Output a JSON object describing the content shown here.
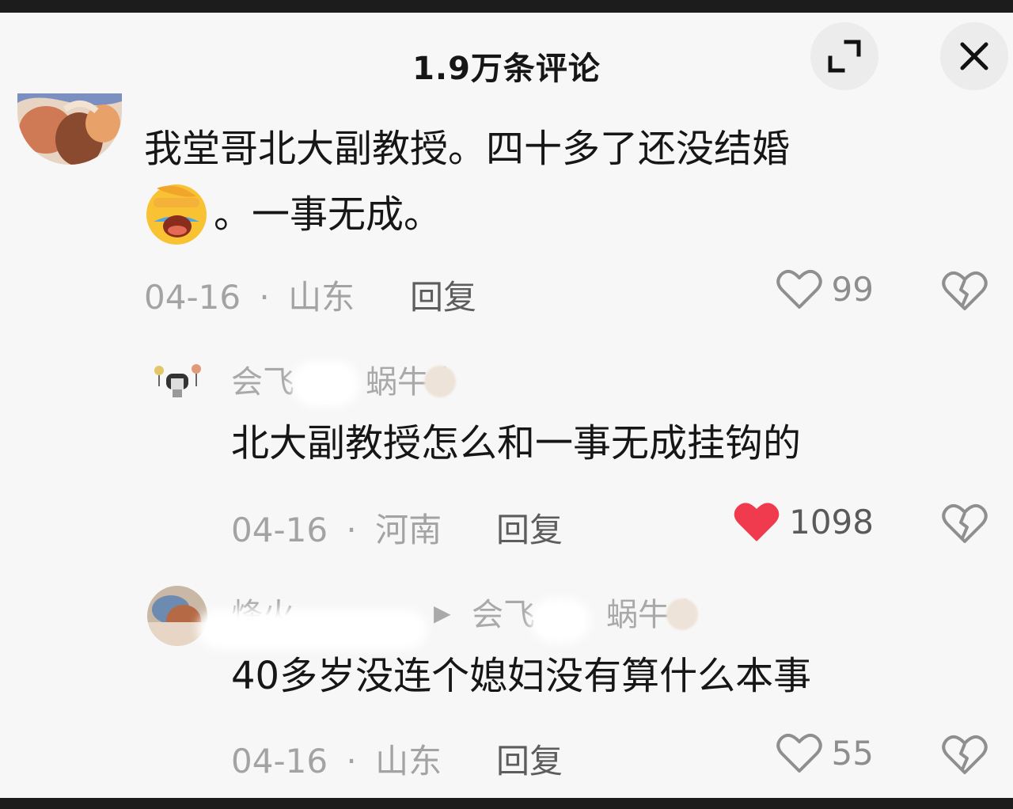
{
  "header": {
    "title": "1.9万条评论"
  },
  "comments": [
    {
      "text_line1": "我堂哥北大副教授。四十多了还没结婚",
      "text_line2": "。一事无成。",
      "date": "04-16",
      "separator": "·",
      "location": "山东",
      "reply_label": "回复",
      "likes": "99",
      "liked": false,
      "emoji": "face-palm-crying-emoji"
    },
    {
      "username_prefix": "会飞",
      "username_suffix": "蜗牛",
      "text": "北大副教授怎么和一事无成挂钩的",
      "date": "04-16",
      "separator": "·",
      "location": "河南",
      "reply_label": "回复",
      "likes": "1098",
      "liked": true
    },
    {
      "username": "烽火",
      "reply_to_prefix": "会飞",
      "reply_to_suffix": "蜗牛",
      "text": "40多岁没连个媳妇没有算什么本事",
      "date": "04-16",
      "separator": "·",
      "location": "山东",
      "reply_label": "回复",
      "likes": "55",
      "liked": false
    }
  ],
  "colors": {
    "like_active": "#f03a4d",
    "icon_gray": "#8f8f8f"
  },
  "icons": {
    "expand": "expand-icon",
    "close": "close-icon",
    "like": "heart-icon",
    "dislike": "broken-heart-icon",
    "reply_arrow": "triangle-right-icon"
  }
}
